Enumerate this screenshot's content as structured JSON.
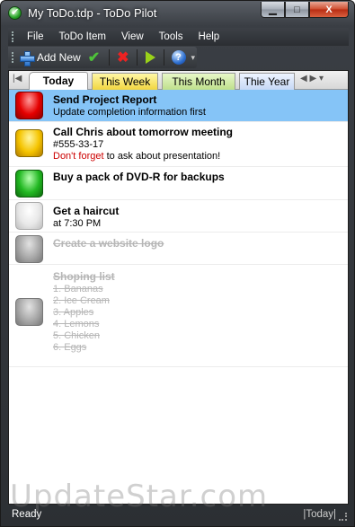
{
  "window": {
    "title": "My ToDo.tdp - ToDo Pilot",
    "min_glyph": "▁",
    "max_glyph": "□",
    "close_glyph": "X"
  },
  "menu": [
    "File",
    "ToDo Item",
    "View",
    "Tools",
    "Help"
  ],
  "toolbar": {
    "add_label": "Add New",
    "icons": [
      "plus-icon",
      "check-icon",
      "x-icon",
      "play-icon",
      "help-icon"
    ]
  },
  "tabs": {
    "prev_glyph": "|◀",
    "today": "Today",
    "week": "This Week",
    "month": "This Month",
    "year": "Thie Year",
    "nav_glyph": "◀ ▶ ▾"
  },
  "items": [
    {
      "status": "red",
      "title": "Send Project Report",
      "line1": "Update completion information first"
    },
    {
      "status": "yellow",
      "title": "Call Chris about tomorrow meeting",
      "line1": "#555-33-17",
      "line2_red": "Don't forget",
      "line2_rest": " to ask about presentation!"
    },
    {
      "status": "green",
      "title": "Buy a pack of DVD-R for backups"
    },
    {
      "status": "white",
      "title": "Get a haircut",
      "line1": "at 7:30 PM"
    },
    {
      "status": "grey",
      "title": "Create a website logo"
    },
    {
      "status": "grey",
      "title": "Shoping list",
      "sublines": [
        "1. Bananas",
        "2. Ice Cream",
        "3. Apples",
        "4. Lemons",
        "5. Chicken",
        "6. Eggs"
      ]
    }
  ],
  "watermark": "UpdateStar.com",
  "status": {
    "left": "Ready",
    "right": "|Today|"
  },
  "colors": {
    "selection": "#85c4f7",
    "chrome": "#2c2f33",
    "accent_red": "#cc0000"
  }
}
